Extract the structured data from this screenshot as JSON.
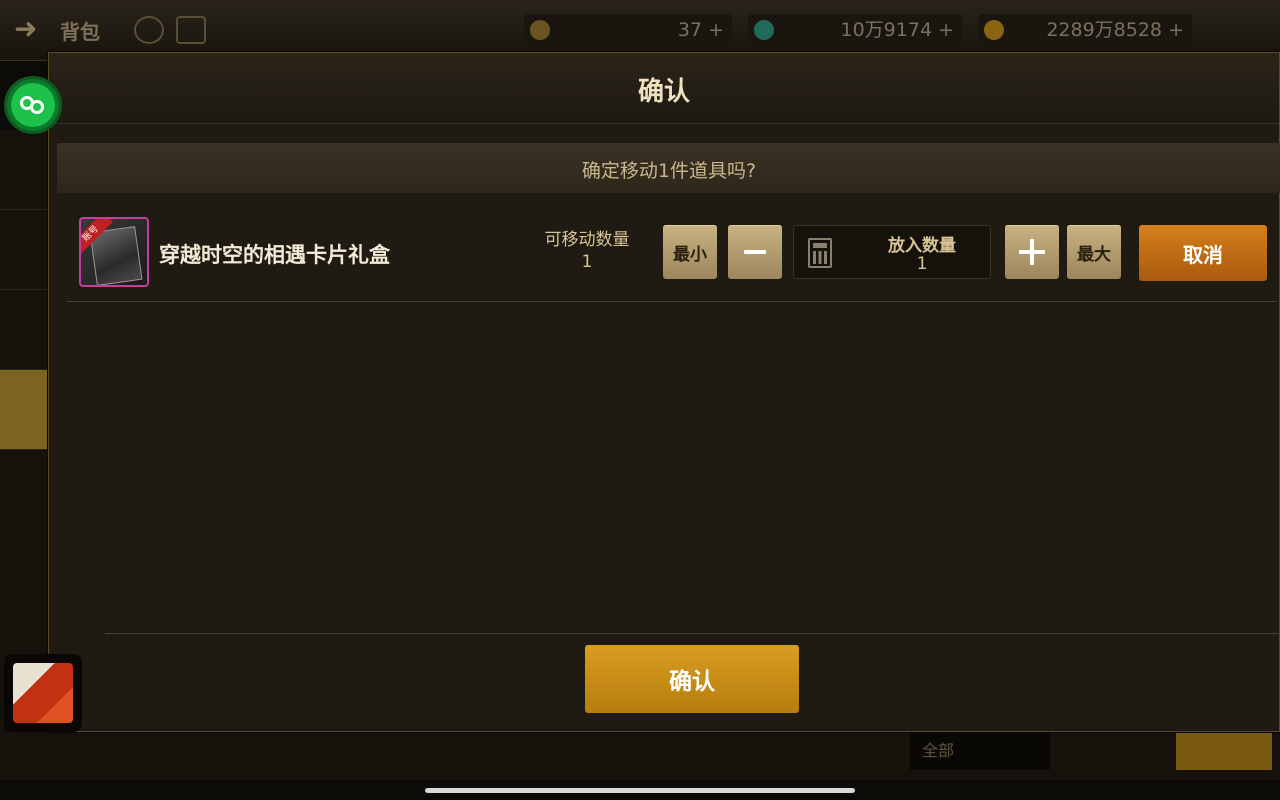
{
  "background": {
    "screen_title": "背包",
    "resources": [
      {
        "icon": "crescent-icon",
        "value": "37",
        "color": "#c9a040"
      },
      {
        "icon": "gem-icon",
        "value": "10万9174",
        "color": "#40c8b0"
      },
      {
        "icon": "gold-coin-icon",
        "value": "2289万8528",
        "color": "#d8a020"
      }
    ],
    "bottom_select": "全部"
  },
  "modal": {
    "title": "确认",
    "question": "确定移动1件道具吗?",
    "item": {
      "name": "穿越时空的相遇卡片礼盒",
      "badge": "账号",
      "movable_label": "可移动数量",
      "movable_value": "1"
    },
    "controls": {
      "min_label": "最小",
      "max_label": "最大",
      "qty_label": "放入数量",
      "qty_value": "1",
      "cancel_label": "取消"
    },
    "confirm_label": "确认"
  },
  "colors": {
    "accent_orange": "#c0700f",
    "accent_gold": "#c88d16",
    "beige_button": "#b39e6f"
  }
}
